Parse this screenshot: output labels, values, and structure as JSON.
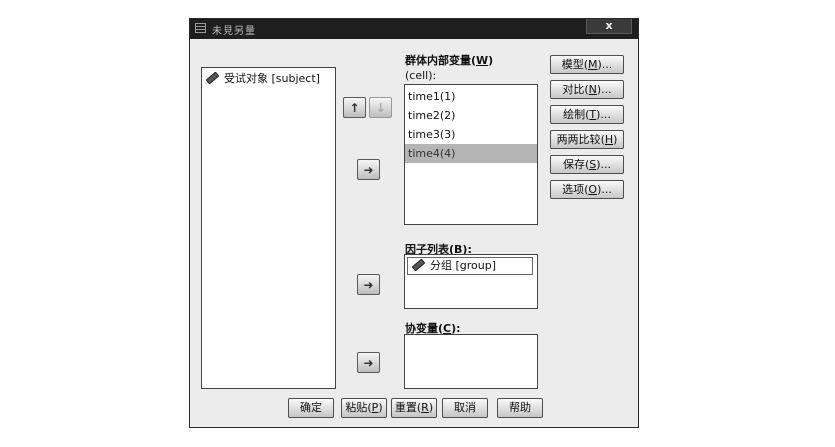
{
  "window": {
    "title": "未見另量",
    "close_label": "x"
  },
  "source_list": {
    "items": [
      {
        "label": "受试对象 [subject]",
        "icon": "ruler-icon"
      }
    ]
  },
  "within_subjects": {
    "label": "群体内部变量",
    "mnemonic": "W",
    "sublabel": "(cell):",
    "items": [
      {
        "label": "time1(1)",
        "selected": false
      },
      {
        "label": "time2(2)",
        "selected": false
      },
      {
        "label": "time3(3)",
        "selected": false
      },
      {
        "label": "time4(4)",
        "selected": true
      }
    ]
  },
  "factor_list": {
    "label": "因子列表",
    "mnemonic": "B",
    "suffix": "):",
    "items": [
      {
        "label": "分组 [group]",
        "icon": "ruler-icon"
      }
    ]
  },
  "covariates": {
    "label": "协变量",
    "mnemonic": "C",
    "suffix": "):",
    "items": []
  },
  "arrows": {
    "move_up": "↑",
    "move_down": "↓",
    "move_right": "➜"
  },
  "side_buttons": [
    {
      "text": "模型",
      "mnemonic": "M",
      "suffix": ")..."
    },
    {
      "text": "对比",
      "mnemonic": "N",
      "suffix": ")..."
    },
    {
      "text": "绘制",
      "mnemonic": "T",
      "suffix": ")..."
    },
    {
      "text": "两两比较",
      "mnemonic": "H",
      "suffix": ")"
    },
    {
      "text": "保存",
      "mnemonic": "S",
      "suffix": ")..."
    },
    {
      "text": "选项",
      "mnemonic": "O",
      "suffix": ")..."
    }
  ],
  "bottom_buttons": [
    {
      "text": "确定",
      "mnemonic": "",
      "suffix": ""
    },
    {
      "text": "粘贴",
      "mnemonic": "P",
      "suffix": ")"
    },
    {
      "text": "重置",
      "mnemonic": "R",
      "suffix": ")"
    },
    {
      "text": "取消",
      "mnemonic": "",
      "suffix": ""
    },
    {
      "text": "帮助",
      "mnemonic": "",
      "suffix": ""
    }
  ]
}
